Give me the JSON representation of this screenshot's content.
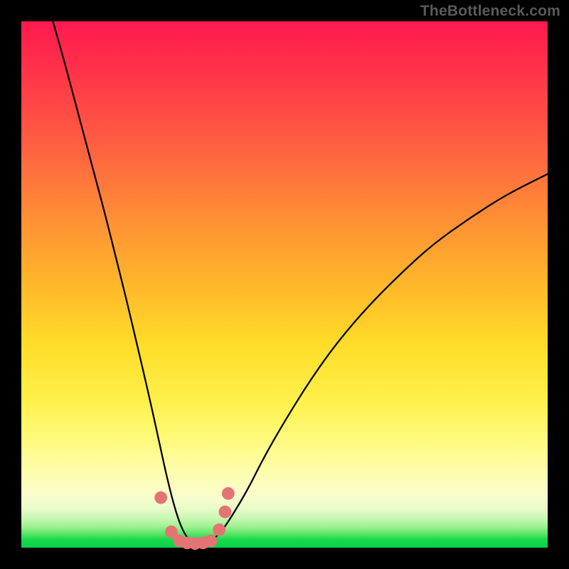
{
  "watermark": "TheBottleneck.com",
  "chart_data": {
    "type": "line",
    "title": "",
    "xlabel": "",
    "ylabel": "",
    "xlim": [
      0,
      100
    ],
    "ylim": [
      0,
      100
    ],
    "background_gradient": {
      "orientation": "vertical",
      "stops": [
        {
          "pct": 0,
          "color": "#ff1a4f"
        },
        {
          "pct": 8,
          "color": "#ff2f4a"
        },
        {
          "pct": 22,
          "color": "#ff5a43"
        },
        {
          "pct": 36,
          "color": "#ff8a36"
        },
        {
          "pct": 50,
          "color": "#ffb72a"
        },
        {
          "pct": 62,
          "color": "#ffde2a"
        },
        {
          "pct": 72,
          "color": "#fff04a"
        },
        {
          "pct": 80,
          "color": "#fffb80"
        },
        {
          "pct": 86,
          "color": "#fdfdb0"
        },
        {
          "pct": 90,
          "color": "#fbfdcb"
        },
        {
          "pct": 92.5,
          "color": "#e9fbca"
        },
        {
          "pct": 94.5,
          "color": "#c7f7b0"
        },
        {
          "pct": 96,
          "color": "#9ef191"
        },
        {
          "pct": 97.5,
          "color": "#52e462"
        },
        {
          "pct": 98.5,
          "color": "#18d94f"
        },
        {
          "pct": 100,
          "color": "#06d246"
        }
      ]
    },
    "series": [
      {
        "name": "bottleneck-curve",
        "color": "#000000",
        "x": [
          6,
          8,
          10,
          12,
          14,
          16,
          18,
          20,
          22,
          24,
          26,
          27.5,
          29,
          30.5,
          32,
          34,
          36,
          38,
          40,
          43,
          46,
          50,
          55,
          60,
          66,
          72,
          78,
          85,
          92,
          100
        ],
        "y": [
          100,
          93,
          85.5,
          78,
          70.5,
          63,
          55,
          47,
          38.5,
          30,
          21,
          14,
          8,
          3.5,
          1.2,
          0.6,
          1.2,
          3,
          6,
          11,
          17,
          24,
          32,
          39,
          46,
          52,
          57.5,
          62.5,
          67,
          71
        ]
      }
    ],
    "marker_cluster": {
      "color": "#e57373",
      "radius_pct": 1.2,
      "points": [
        {
          "x": 26.5,
          "y": 9.5
        },
        {
          "x": 28.5,
          "y": 3.0
        },
        {
          "x": 30.0,
          "y": 1.3
        },
        {
          "x": 31.5,
          "y": 0.9
        },
        {
          "x": 33.0,
          "y": 0.8
        },
        {
          "x": 34.5,
          "y": 0.9
        },
        {
          "x": 36.0,
          "y": 1.3
        },
        {
          "x": 37.6,
          "y": 3.4
        },
        {
          "x": 38.7,
          "y": 6.8
        },
        {
          "x": 39.3,
          "y": 10.3
        }
      ]
    }
  }
}
